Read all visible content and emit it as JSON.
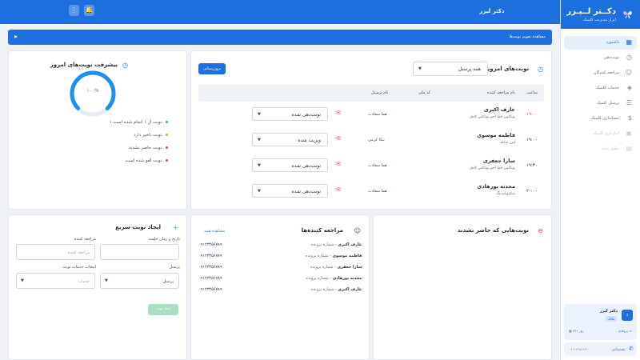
{
  "topbar": {
    "title": "دکتر لیزر",
    "menu_icon": "vertical-dots-icon",
    "bell_icon": "bell-icon"
  },
  "sidebar": {
    "logo_title": "دکــتر لــیـزر",
    "logo_subtitle": "ابزار مدیریت کلینیک",
    "items": [
      {
        "label": "داشبورد",
        "icon": "grid-icon",
        "active": true
      },
      {
        "label": "نوبت‌دهی",
        "icon": "clock-icon"
      },
      {
        "label": "مراجعه کنندگان",
        "icon": "user-icon"
      },
      {
        "label": "خدمات کلینیک",
        "icon": "tag-icon"
      },
      {
        "label": "پرسنل کلینیک",
        "icon": "users-icon"
      },
      {
        "label": "حسابداری کلینیک",
        "icon": "dollar-icon"
      },
      {
        "label": "انبارداری کلینیک",
        "icon": "box-icon",
        "disabled": true
      },
      {
        "label": "تحلیل داده",
        "icon": "chart-icon",
        "disabled": true
      }
    ],
    "user": {
      "avatar": "د",
      "name": "دکتر لیزر",
      "badge": "مالک",
      "profile": "پروفایل",
      "coins": "۳۴۶ روز"
    },
    "support": {
      "label": "پشتیبانی",
      "phone": "۰۹۱۲۳۴۵۶۷۸۹"
    }
  },
  "banner": {
    "text": "مشاهده تقویم نوبت‌ها"
  },
  "progress": {
    "title": "پیشرفت نوبت‌های امروز",
    "percent_label": "۱۰۰%",
    "percent_value": 100,
    "lines": [
      {
        "text": "۱ نوبت از ۱ انجام شده است.",
        "color": "#2ebd6b"
      },
      {
        "text": "نوبت تاخیر دارد.",
        "color": "#f0a020"
      },
      {
        "text": "نوبت حاضر نشدند.",
        "color": "#e04848"
      },
      {
        "text": "نوبت لغو شده است.",
        "color": "#e04848"
      }
    ]
  },
  "appointments": {
    "title": "نوبت‌های امروز برای",
    "filter_value": "همه پرسنل",
    "update_label": "بروزرسانی",
    "columns": [
      "ساعت",
      "نام مراجعه کننده",
      "کد ملی",
      "نام پرسنل"
    ],
    "rows": [
      {
        "time": "۱۹:۰۰",
        "time_color": "#e04848",
        "name": "عارف اکبری",
        "service": "بوتاکس خط اخم،بوتاکس کامل",
        "staff": "هما سعادت",
        "status": "نوبت‌دهی شده"
      },
      {
        "time": "۱۹:۰۰",
        "time_color": "#1f2a3a",
        "name": "فاطمه موسوی",
        "service": "لیزر ساعد",
        "staff": "نیکا کرمی",
        "status": "ویزیت شده"
      },
      {
        "time": "۱۹:۳۰",
        "time_color": "#1f2a3a",
        "name": "سارا جعفری",
        "service": "بوتاکس خط اخم،بوتاکس کامل",
        "staff": "هما سعادت",
        "status": "نوبت‌دهی شده"
      },
      {
        "time": "۲۰:۰۰",
        "time_color": "#1f2a3a",
        "name": "محدثه پورهادی",
        "service": "میکروبلیدینگ",
        "staff": "هما سعادت",
        "status": "نوبت‌دهی شده"
      }
    ]
  },
  "quick": {
    "title": "ایجاد نوبت سریع",
    "date_label": "تاریخ و زمان جلسه",
    "patient_label": "مراجعه کننده",
    "patient_placeholder": "مراجعه کننده",
    "staff_label": "پرسنل",
    "staff_value": "پرسنل",
    "service_label": "انتخاب خدمات نوبت",
    "service_placeholder": "خدمات",
    "submit": "ایجاد نوبت"
  },
  "patients": {
    "title": "مراجعه کننده‌ها",
    "see_all": "مشاهده همه",
    "file_label": " - شماره پرونده:",
    "items": [
      {
        "name": "عارف اکبری",
        "phone": "۰۹۱۲۳۴۵۶۷۸۹"
      },
      {
        "name": "فاطمه موسوی",
        "phone": "۰۹۱۲۳۴۵۶۷۸۹"
      },
      {
        "name": "سارا جعفری",
        "phone": "۰۹۱۲۳۴۵۶۷۸۹"
      },
      {
        "name": "محدثه پورهادی",
        "phone": "۰۹۱۲۳۴۵۶۷۸۹"
      },
      {
        "name": "عارف اکبری",
        "phone": "۰۹۱۲۳۴۵۶۷۸۹"
      }
    ]
  },
  "noshow": {
    "title": "نوبت‌هایی که حاضر نشدند"
  }
}
